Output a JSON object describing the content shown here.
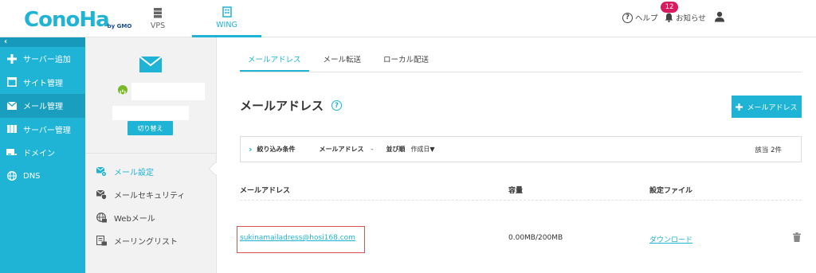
{
  "header": {
    "logo_text": "ConoHa",
    "logo_sub": "by GMO",
    "nav": [
      {
        "label": "VPS",
        "icon": "server-icon"
      },
      {
        "label": "WING",
        "icon": "building-icon",
        "active": true
      }
    ],
    "help_label": "ヘルプ",
    "notice_label": "お知らせ",
    "notice_count": "12"
  },
  "sidebar": {
    "collapse_glyph": "‹",
    "items": [
      {
        "label": "サーバー追加",
        "icon": "plus-icon"
      },
      {
        "label": "サイト管理",
        "icon": "window-icon"
      },
      {
        "label": "メール管理",
        "icon": "mail-icon",
        "active": true
      },
      {
        "label": "サーバー管理",
        "icon": "server-rack-icon"
      },
      {
        "label": "ドメイン",
        "icon": "domain-icon"
      },
      {
        "label": "DNS",
        "icon": "globe-icon"
      }
    ]
  },
  "account": {
    "switch_label": "切り替え",
    "menu": [
      {
        "label": "メール設定",
        "icon": "mail-settings-icon",
        "active": true
      },
      {
        "label": "メールセキュリティ",
        "icon": "mail-security-icon"
      },
      {
        "label": "Webメール",
        "icon": "webmail-icon"
      },
      {
        "label": "メーリングリスト",
        "icon": "mailing-list-icon"
      }
    ]
  },
  "main": {
    "tabs": [
      {
        "label": "メールアドレス",
        "active": true
      },
      {
        "label": "メール転送"
      },
      {
        "label": "ローカル配送"
      }
    ],
    "title": "メールアドレス",
    "add_button": "メールアドレス",
    "filter": {
      "label": "絞り込み条件",
      "key1": "メールアドレス",
      "val1": "-",
      "key2": "並び順",
      "val2": "作成日▼",
      "count": "該当 2件"
    },
    "columns": [
      "メールアドレス",
      "容量",
      "設定ファイル"
    ],
    "rows": [
      {
        "email": "sukinamailadress@hosi168.com",
        "capacity": "0.00MB/200MB",
        "config": "ダウンロード"
      }
    ]
  },
  "colors": {
    "accent": "#1fb3d6",
    "highlight_box": "#d9534f",
    "badge": "#d81b60"
  }
}
